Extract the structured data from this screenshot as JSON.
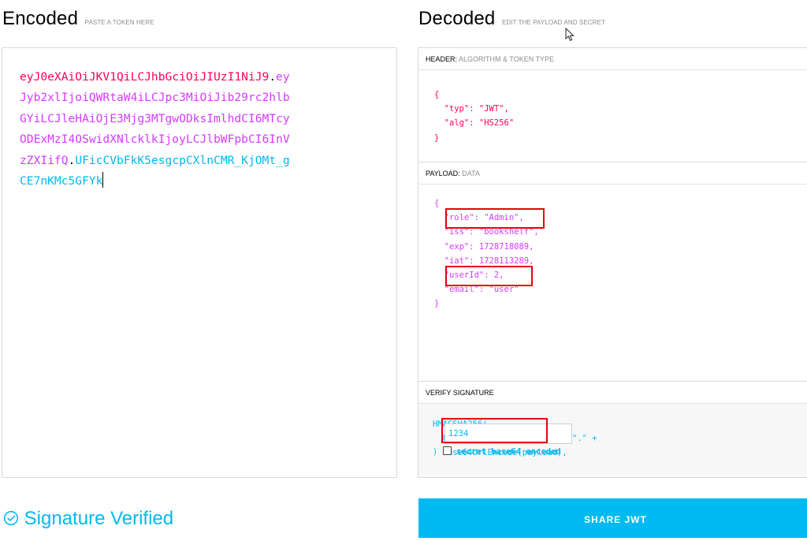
{
  "encoded": {
    "title": "Encoded",
    "subtitle": "PASTE A TOKEN HERE",
    "lines": [
      {
        "header": "eyJ0eXAiOiJKV1QiLCJhbGciOiJIUzI1NiJ9",
        "dot": ".",
        "payload": "ey"
      },
      {
        "payload": "Jyb2xlIjoiQWRtaW4iLCJpc3MiOiJib29rc2hlb"
      },
      {
        "payload": "GYiLCJleHAiOjE3Mjg3MTgwODksImlhdCI6MTcy"
      },
      {
        "payload": "ODExMzI4OSwidXNlcklkIjoyLCJlbWFpbCI6InV"
      },
      {
        "payload": "zZXIifQ",
        "dot": ".",
        "sig": "UFicCVbFkK5esgcpCXlnCMR_KjOMt_g"
      },
      {
        "sig": "CE7nKMc5GFYk"
      }
    ]
  },
  "decoded": {
    "title": "Decoded",
    "subtitle": "EDIT THE PAYLOAD AND SECRET",
    "header_panel": {
      "label": "HEADER:",
      "label_muted": "ALGORITHM & TOKEN TYPE",
      "code": "{\n  \"typ\": \"JWT\",\n  \"alg\": \"HS256\"\n}"
    },
    "payload_panel": {
      "label": "PAYLOAD:",
      "label_muted": "DATA",
      "code": "{\n  \"role\": \"Admin\",\n  \"iss\": \"bookshelf\",\n  \"exp\": 1728718089,\n  \"iat\": 1728113289,\n  \"userId\": 2,\n  \"email\": \"user\"\n}"
    },
    "verify_panel": {
      "label": "VERIFY SIGNATURE",
      "code": "HMACSHA256(\n  base64UrlEncode(header) + \".\" +\n  base64UrlEncode(payload),",
      "secret_value": "1234",
      "closing": ")",
      "checkbox_label": "secret base64 encoded"
    }
  },
  "status": {
    "icon": "check-circle-icon",
    "text": "Signature Verified"
  },
  "share_button": "SHARE JWT",
  "colors": {
    "header": "#fb015b",
    "payload": "#d63aff",
    "signature": "#00b9f1",
    "highlight": "#e8000d"
  }
}
